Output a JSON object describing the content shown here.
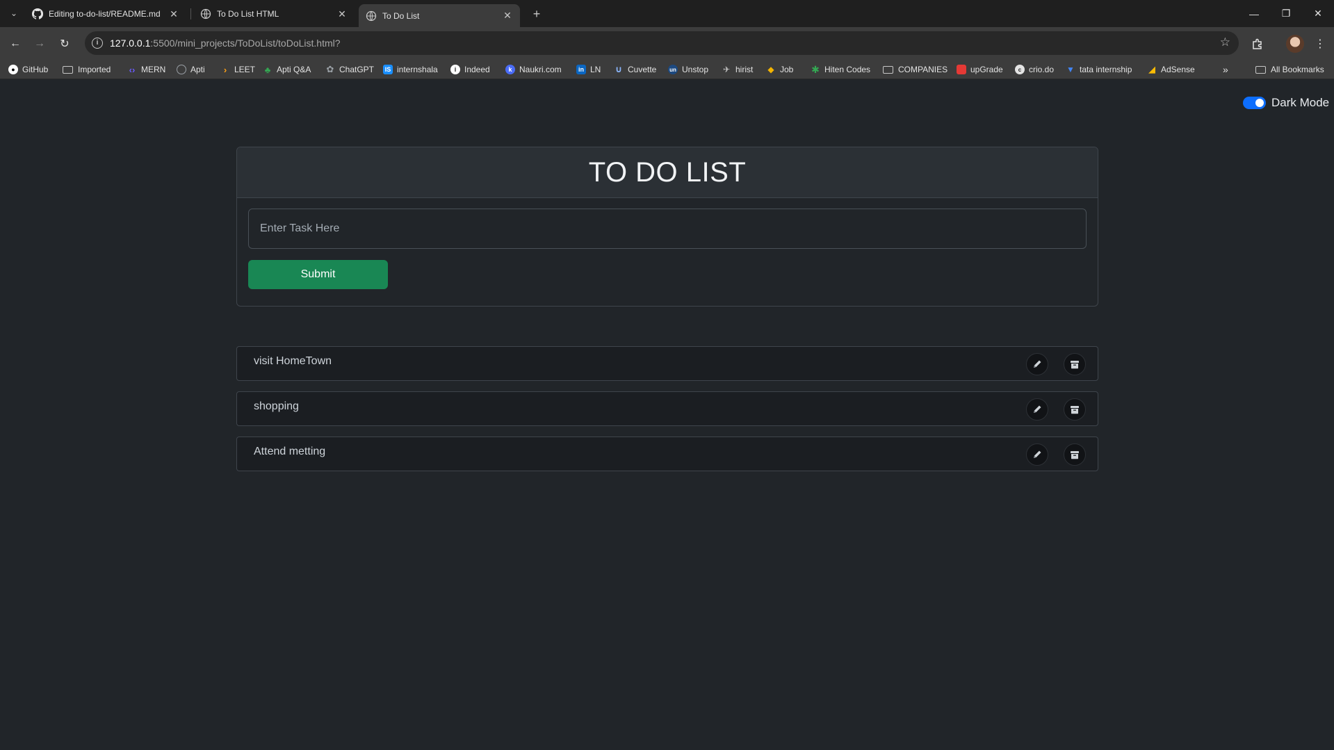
{
  "browser": {
    "tabs": [
      {
        "title": "Editing to-do-list/README.md",
        "icon": "github-icon",
        "active": false
      },
      {
        "title": "To Do List HTML",
        "icon": "globe-icon",
        "active": false
      },
      {
        "title": "To Do List",
        "icon": "globe-icon",
        "active": true
      }
    ],
    "url": {
      "host": "127.0.0.1",
      "path": ":5500/mini_projects/ToDoList/toDoList.html?"
    },
    "bookmarks": [
      {
        "label": "GitHub",
        "icon": "github-icon",
        "color": "#ffffff"
      },
      {
        "label": "Imported",
        "icon": "folder-icon",
        "color": "#c7c7c7"
      },
      {
        "label": "MERN",
        "icon": "code-icon",
        "color": "#6b5bff"
      },
      {
        "label": "Apti",
        "icon": "globe-icon",
        "color": "#9aa0a6"
      },
      {
        "label": "LEET",
        "icon": "leetcode-icon",
        "color": "#ffa116"
      },
      {
        "label": "Apti Q&A",
        "icon": "leaf-icon",
        "color": "#34a853"
      },
      {
        "label": "ChatGPT",
        "icon": "openai-icon",
        "color": "#9aa0a6"
      },
      {
        "label": "internshala",
        "icon": "internshala-icon",
        "color": "#1a8fff"
      },
      {
        "label": "Indeed",
        "icon": "info-icon",
        "color": "#ffffff"
      },
      {
        "label": "Naukri.com",
        "icon": "naukri-icon",
        "color": "#4a6cf7"
      },
      {
        "label": "LN",
        "icon": "linkedin-icon",
        "color": "#0a66c2"
      },
      {
        "label": "Cuvette",
        "icon": "cuvette-icon",
        "color": "#8ab4f8"
      },
      {
        "label": "Unstop",
        "icon": "unstop-icon",
        "color": "#1c4980"
      },
      {
        "label": "hirist",
        "icon": "hirist-icon",
        "color": "#9aa0a6"
      },
      {
        "label": "Job",
        "icon": "job-icon",
        "color": "#f4b400"
      },
      {
        "label": "Hiten Codes",
        "icon": "asterisk-icon",
        "color": "#34a853"
      },
      {
        "label": "COMPANIES",
        "icon": "folder-icon",
        "color": "#c7c7c7"
      },
      {
        "label": "upGrade",
        "icon": "upgrad-icon",
        "color": "#e53935"
      },
      {
        "label": "crio.do",
        "icon": "crio-icon",
        "color": "#9aa0a6"
      },
      {
        "label": "tata internship",
        "icon": "tata-icon",
        "color": "#4285f4"
      },
      {
        "label": "AdSense",
        "icon": "adsense-icon",
        "color": "#fbbc04"
      }
    ],
    "all_bookmarks_label": "All Bookmarks"
  },
  "page": {
    "dark_mode_label": "Dark Mode",
    "dark_mode_on": true,
    "title": "TO DO LIST",
    "input_placeholder": "Enter Task Here",
    "input_value": "",
    "submit_label": "Submit",
    "tasks": [
      {
        "text": "visit HomeTown"
      },
      {
        "text": "shopping"
      },
      {
        "text": "Attend metting"
      }
    ],
    "colors": {
      "background": "#212529",
      "submit": "#198754",
      "switch": "#0d6efd"
    }
  }
}
